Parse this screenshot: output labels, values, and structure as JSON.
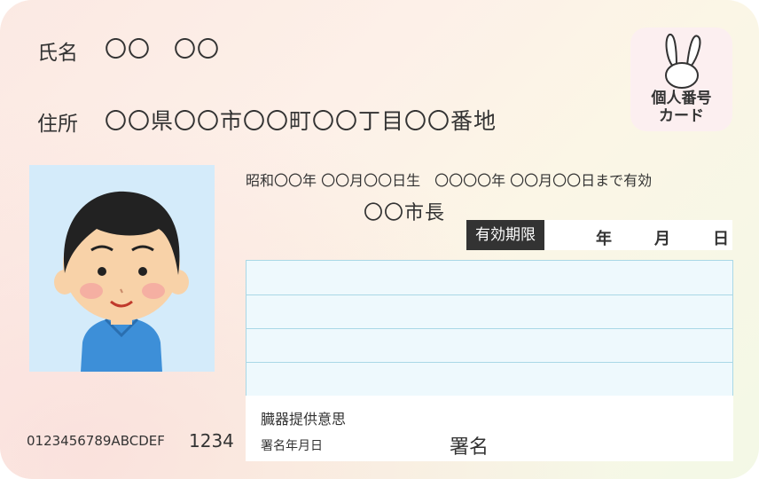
{
  "name": {
    "label": "氏名",
    "value": "〇〇　〇〇"
  },
  "address": {
    "label": "住所",
    "value": "〇〇県〇〇市〇〇町〇〇丁目〇〇番地"
  },
  "logo": {
    "line1": "個人番号",
    "line2": "カード"
  },
  "birth_and_validity": "昭和〇〇年 〇〇月〇〇日生　〇〇〇〇年 〇〇月〇〇日まで有効",
  "issuer": "〇〇市長",
  "validity_period": {
    "tag": "有効期限",
    "year": "年",
    "month": "月",
    "day": "日"
  },
  "organ_donation": "臓器提供意思",
  "signature_date": "署名年月日",
  "signature": "署名",
  "card_number": "0123456789ABCDEF",
  "card_code": "1234",
  "colors": {
    "photo_bg": "#d4ebfa",
    "memo_bg": "#eef9fd",
    "memo_line": "#a9d8e6",
    "tag_bg": "#333333"
  },
  "icons": {
    "logo": "rabbit-icon",
    "photo": "person-portrait-icon"
  }
}
